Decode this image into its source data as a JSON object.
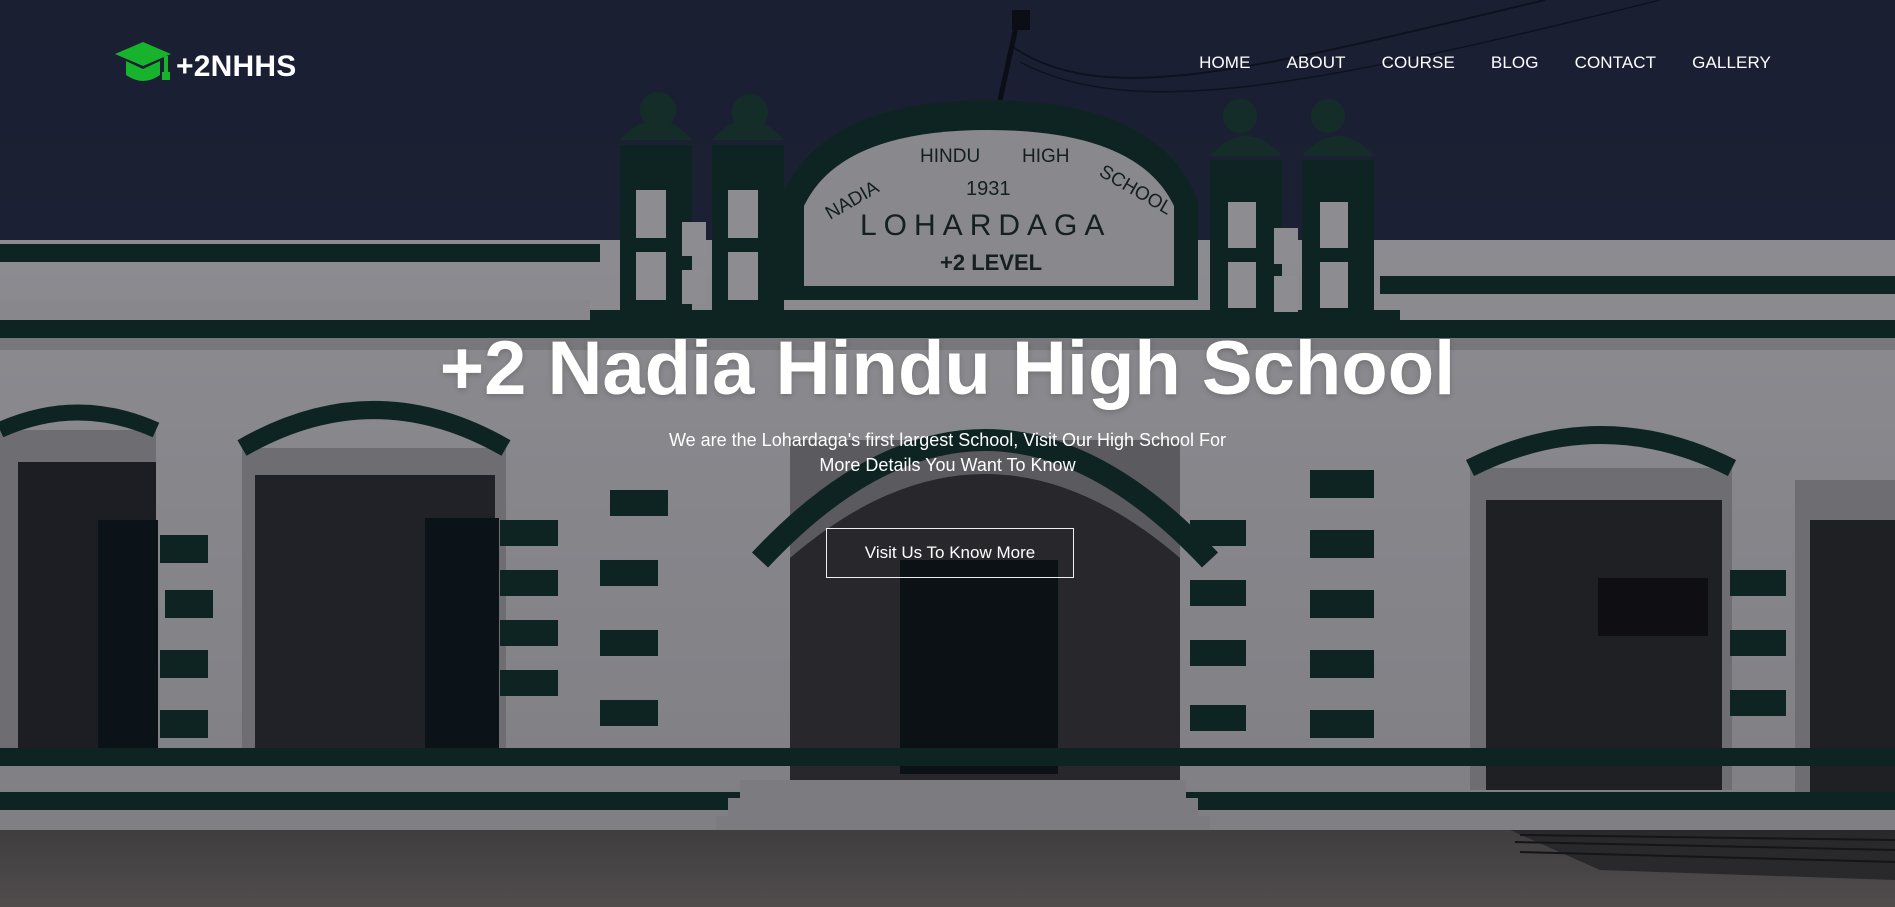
{
  "brand": {
    "logo_text": "+2NHHS",
    "icon": "graduation-cap-icon",
    "accent": "#17b32c"
  },
  "nav": {
    "items": [
      {
        "label": "HOME"
      },
      {
        "label": "ABOUT"
      },
      {
        "label": "COURSE"
      },
      {
        "label": "BLOG"
      },
      {
        "label": "CONTACT"
      },
      {
        "label": "GALLERY"
      }
    ]
  },
  "hero": {
    "title": "+2 Nadia Hindu High School",
    "subtitle_line1": "We are the Lohardaga's first largest School, Visit Our High School For",
    "subtitle_line2": "More Details You Want To Know",
    "cta_label": "Visit Us To Know More",
    "background_text": {
      "school_name_arc": "NADIA HINDU HIGH SCHOOL",
      "year": "1931",
      "town": "LOHARDAGA",
      "level": "+2 LEVEL"
    }
  },
  "colors": {
    "sky": "#2a3146",
    "building_trim": "#123b2d",
    "building_wall": "#d9d9d9",
    "overlay": "rgba(10,12,22,0.45)"
  }
}
